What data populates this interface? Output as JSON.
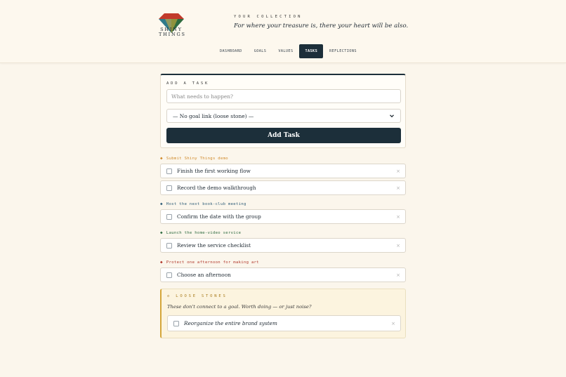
{
  "brand": {
    "name_line1": "SHINY",
    "name_line2": "THINGS",
    "colors": {
      "top": "#c23a2b",
      "left": "#2f7a8a",
      "right": "#2e6b3f",
      "bottom": "#e0b23a"
    }
  },
  "header": {
    "kicker": "YOUR COLLECTION",
    "tagline": "For where your treasure is, there your heart will be also."
  },
  "nav": {
    "tabs": [
      {
        "label": "DASHBOARD",
        "active": false
      },
      {
        "label": "GOALS",
        "active": false
      },
      {
        "label": "VALUES",
        "active": false
      },
      {
        "label": "TASKS",
        "active": true
      },
      {
        "label": "REFLECTIONS",
        "active": false
      }
    ]
  },
  "add_task": {
    "label": "ADD A TASK",
    "input_placeholder": "What needs to happen?",
    "input_value": "",
    "goal_select_value": "— No goal link (loose stone) —",
    "button_label": "Add Task"
  },
  "groups": [
    {
      "name": "Submit Shiny Things demo",
      "color": "#d08a2a",
      "tasks": [
        "Finish the first working flow",
        "Record the demo walkthrough"
      ]
    },
    {
      "name": "Host the next book-club meeting",
      "color": "#2f5d78",
      "tasks": [
        "Confirm the date with the group"
      ]
    },
    {
      "name": "Launch the home-video service",
      "color": "#2e6b3f",
      "tasks": [
        "Review the service checklist"
      ]
    },
    {
      "name": "Protect one afternoon for making art",
      "color": "#b0362a",
      "tasks": [
        "Choose an afternoon"
      ]
    }
  ],
  "loose_stones": {
    "icon": "◇",
    "label": "LOOSE STONES",
    "note": "These don't connect to a goal. Worth doing — or just noise?",
    "tasks": [
      "Reorganize the entire brand system"
    ],
    "color": "#a87b1c"
  },
  "icons": {
    "group_marker": "◆",
    "delete": "×"
  }
}
